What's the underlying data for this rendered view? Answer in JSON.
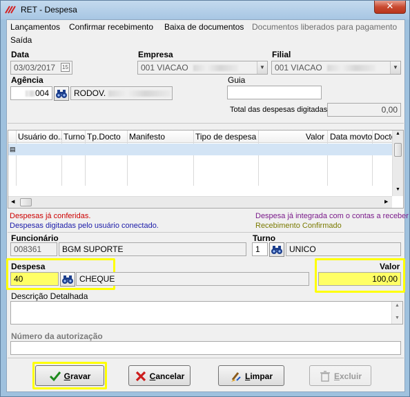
{
  "window": {
    "title": "RET - Despesa"
  },
  "menu": [
    {
      "label": "Lançamentos",
      "disabled": false
    },
    {
      "label": "Confirmar recebimento",
      "disabled": false
    },
    {
      "label": "Baixa de documentos",
      "disabled": false
    },
    {
      "label": "Documentos liberados para pagamento",
      "disabled": true
    },
    {
      "label": "Saída",
      "disabled": false
    }
  ],
  "form": {
    "data_label": "Data",
    "data_value": "03/03/2017",
    "empresa_label": "Empresa",
    "empresa_value": "001 VIACAO",
    "filial_label": "Filial",
    "filial_value": "001 VIACAO",
    "agencia_label": "Agência",
    "agencia_code": "004",
    "agencia_name": "RODOV.",
    "guia_label": "Guia",
    "guia_value": "",
    "total_label": "Total das despesas digitadas",
    "total_value": "0,00"
  },
  "grid": {
    "columns": [
      "Usuário do...",
      "Turno",
      "Tp.Docto",
      "Manifesto",
      "Tipo de despesa",
      "Valor",
      "Data movto",
      "Docto"
    ],
    "rows": []
  },
  "legend": {
    "conferidas": "Despesas já conferidas.",
    "digitadas": "Despesas digitadas pelo usuário conectado.",
    "integrada": "Despesa já integrada com o contas a receber",
    "confirmado": "Recebimento Confirmado",
    "colors": {
      "red": "#cc0000",
      "blue": "#1a1aa8",
      "purple": "#7a1a8a",
      "olive": "#7a7a00"
    }
  },
  "funcionario": {
    "label": "Funcionário",
    "code": "008361",
    "name": "BGM SUPORTE"
  },
  "turno": {
    "label": "Turno",
    "code": "1",
    "name": "UNICO"
  },
  "despesa": {
    "label": "Despesa",
    "code": "40",
    "name": "CHEQUE"
  },
  "valor": {
    "label": "Valor",
    "value": "100,00"
  },
  "descricao": {
    "label": "Descrição Detalhada",
    "value": ""
  },
  "autorizacao": {
    "label": "Número da autorização",
    "value": ""
  },
  "buttons": {
    "gravar_first": "G",
    "gravar_rest": "ravar",
    "cancelar_first": "C",
    "cancelar_rest": "ancelar",
    "limpar_first": "L",
    "limpar_rest": "impar",
    "excluir_first": "E",
    "excluir_rest": "xcluir"
  },
  "highlight_color": "#ffff00"
}
